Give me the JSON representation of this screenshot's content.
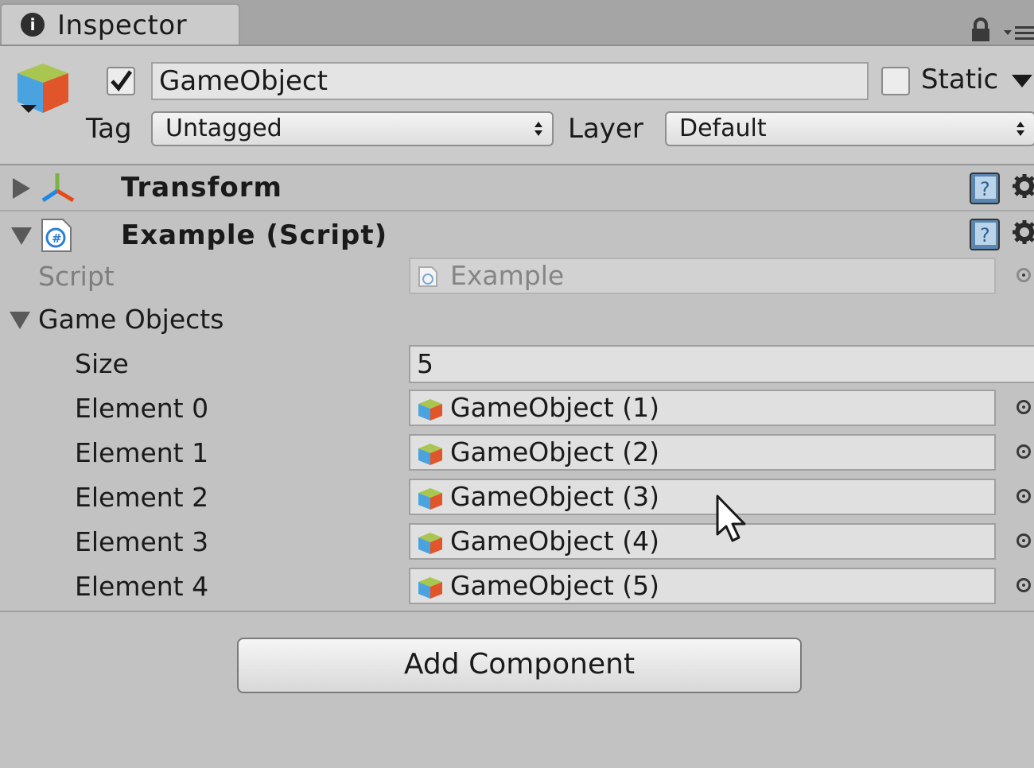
{
  "tab": {
    "label": "Inspector",
    "info_glyph": "i"
  },
  "header": {
    "name": "GameObject",
    "active": true,
    "static_label": "Static",
    "static_checked": false,
    "tag_label": "Tag",
    "tag_value": "Untagged",
    "layer_label": "Layer",
    "layer_value": "Default"
  },
  "components": {
    "transform": {
      "title": "Transform",
      "expanded": false
    },
    "example": {
      "title": "Example (Script)",
      "expanded": true,
      "script_label": "Script",
      "script_value": "Example",
      "array_label": "Game Objects",
      "size_label": "Size",
      "size_value": "5",
      "elements": [
        {
          "label": "Element 0",
          "value": "GameObject (1)"
        },
        {
          "label": "Element 1",
          "value": "GameObject (2)"
        },
        {
          "label": "Element 2",
          "value": "GameObject (3)"
        },
        {
          "label": "Element 3",
          "value": "GameObject (4)"
        },
        {
          "label": "Element 4",
          "value": "GameObject (5)"
        }
      ]
    }
  },
  "add_component_label": "Add Component",
  "icons": [
    "info-icon",
    "lock-icon",
    "tab-menu-icon",
    "gameobject-cube-icon",
    "transform-axes-icon",
    "script-csharp-icon",
    "help-book-icon",
    "gear-icon",
    "object-picker-icon",
    "mouse-cursor-icon"
  ],
  "colors": {
    "background": "#c2c2c2",
    "header": "#cbcbcb",
    "tabbar": "#a5a5a5",
    "field": "#e0e0e0",
    "check": "#1565c0"
  }
}
